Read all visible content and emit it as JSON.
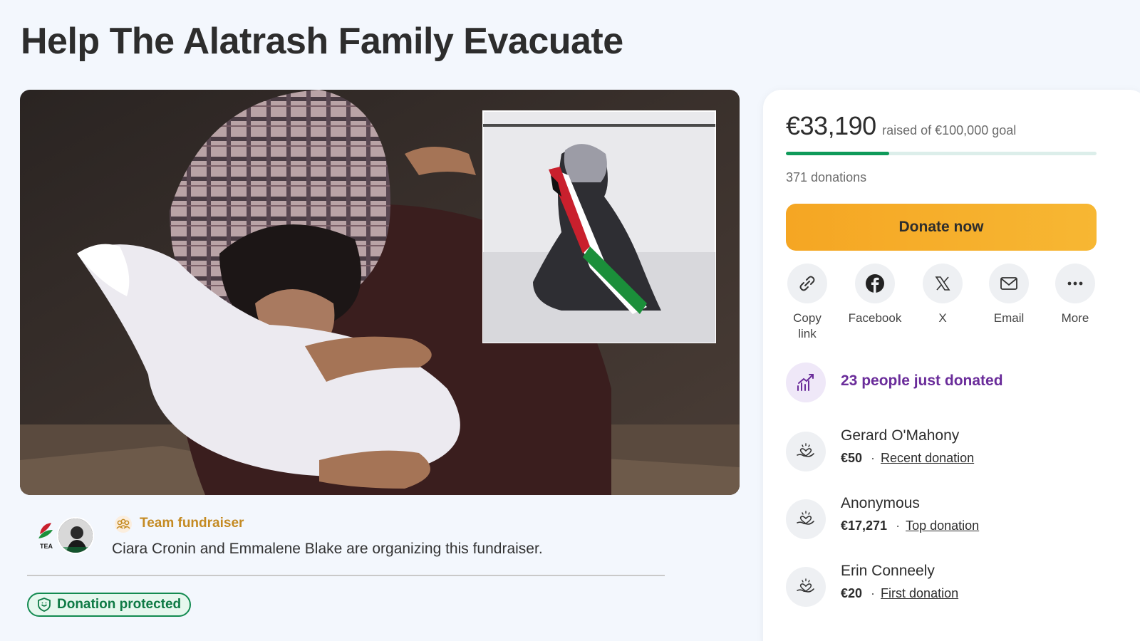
{
  "page": {
    "title": "Help The Alatrash Family Evacuate"
  },
  "organizer": {
    "team_label": "Team fundraiser",
    "text": "Ciara Cronin and Emmalene Blake are organizing this fundraiser.",
    "logo_text": "TEA"
  },
  "badge": {
    "label": "Donation protected"
  },
  "sidebar": {
    "raised_amount": "€33,190",
    "goal_text": "raised of €100,000 goal",
    "progress_fraction": 0.3319,
    "donation_count": "371 donations",
    "donate_label": "Donate now",
    "shares": [
      {
        "label": "Copy link",
        "icon": "link-icon"
      },
      {
        "label": "Facebook",
        "icon": "facebook-icon"
      },
      {
        "label": "X",
        "icon": "x-icon"
      },
      {
        "label": "Email",
        "icon": "email-icon"
      },
      {
        "label": "More",
        "icon": "more-icon"
      }
    ],
    "just_donated": "23 people just donated",
    "donors": [
      {
        "name": "Gerard O'Mahony",
        "amount": "€50",
        "type": "Recent donation"
      },
      {
        "name": "Anonymous",
        "amount": "€17,271",
        "type": "Top donation"
      },
      {
        "name": "Erin Conneely",
        "amount": "€20",
        "type": "First donation"
      }
    ]
  },
  "colors": {
    "accent_green": "#0f9a5a",
    "donate_orange": "#f5a623",
    "purple": "#6a2c9a",
    "team_gold": "#c48a22"
  }
}
